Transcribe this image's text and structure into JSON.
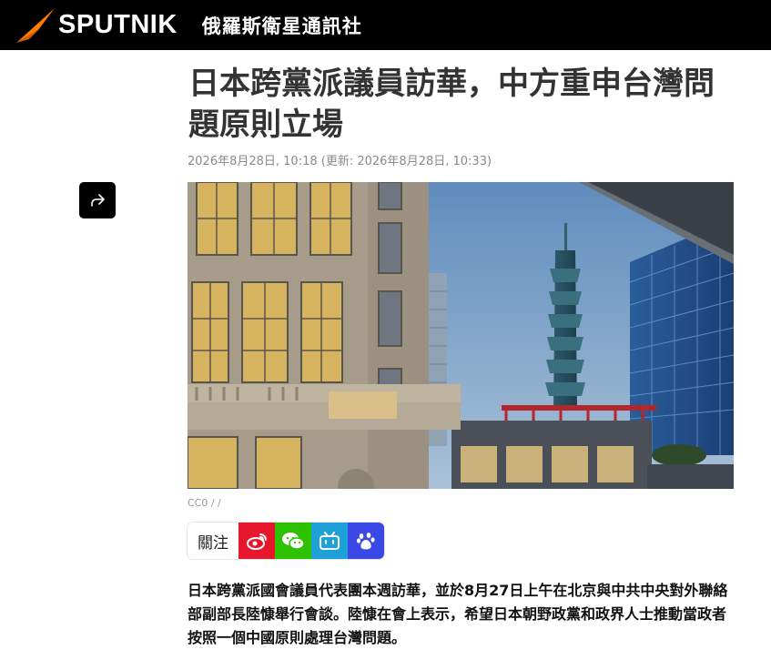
{
  "header": {
    "logo_text": "SPUTNIK",
    "brand_subtitle": "俄羅斯衛星通訊社"
  },
  "article": {
    "title": "日本跨黨派議員訪華，中方重申台灣問題原則立場",
    "meta": "2026年8月28日, 10:18 (更新: 2026年8月28日, 10:33)",
    "image_credit": "CC0 / /",
    "follow_label": "關注",
    "lead": "日本跨黨派國會議員代表團本週訪華，並於8月27日上午在北京與中共中央對外聯絡部副部長陸慷舉行會談。陸慷在會上表示，希望日本朝野政黨和政界人士推動當政者按照一個中國原則處理台灣問題。"
  },
  "social": [
    {
      "icon": "weibo-icon",
      "color": "#e6162d"
    },
    {
      "icon": "wechat-icon",
      "color": "#2dc100"
    },
    {
      "icon": "bilibili-icon",
      "color": "#1da1d6"
    },
    {
      "icon": "baidu-icon",
      "color": "#3a48e6"
    }
  ],
  "colors": {
    "header_bg": "#000000",
    "logo_accent": "#ff7a00"
  }
}
